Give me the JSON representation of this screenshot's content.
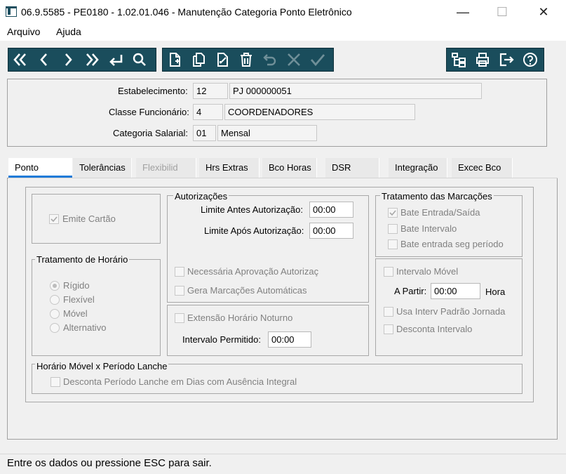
{
  "window": {
    "title": "06.9.5585 - PE0180 - 1.02.01.046 - Manutenção Categoria Ponto Eletrônico",
    "minimize": "—",
    "maximize": "☐",
    "close": "✕"
  },
  "menu": {
    "arquivo": "Arquivo",
    "ajuda": "Ajuda"
  },
  "toolbar": {
    "nav": [
      "first-icon",
      "prev-icon",
      "next-icon",
      "last-icon",
      "goto-icon",
      "search-icon"
    ],
    "edit": [
      "new-icon",
      "copy-icon",
      "modify-icon",
      "delete-icon",
      "undo-icon",
      "cancel-icon",
      "confirm-icon"
    ],
    "misc": [
      "tree-icon",
      "print-icon",
      "exit-icon",
      "help-icon"
    ],
    "color": "#1a4d5c"
  },
  "header": {
    "estab_label": "Estabelecimento:",
    "estab_code": "12",
    "estab_name": "PJ 000000051",
    "classe_label": "Classe Funcionário:",
    "classe_code": "4",
    "classe_name": "COORDENADORES",
    "categ_label": "Categoria Salarial:",
    "categ_code": "01",
    "categ_name": "Mensal"
  },
  "tabs": [
    {
      "label": "Ponto"
    },
    {
      "label": "Tolerâncias"
    },
    {
      "label": "Flexibilid"
    },
    {
      "label": "Hrs Extras"
    },
    {
      "label": "Bco Horas"
    },
    {
      "label": "DSR"
    },
    {
      "label": "Integração"
    },
    {
      "label": "Excec Bco"
    }
  ],
  "ponto": {
    "emite_cartao": "Emite Cartão",
    "tratamento_horario": {
      "title": "Tratamento de Horário",
      "options": [
        "Rígido",
        "Flexível",
        "Móvel",
        "Alternativo"
      ],
      "selected": "Rígido"
    },
    "autorizacoes": {
      "title": "Autorizações",
      "limite_antes_label": "Limite Antes Autorização:",
      "limite_antes_value": "00:00",
      "limite_apos_label": "Limite Após Autorização:",
      "limite_apos_value": "00:00",
      "necessaria": "Necessária Aprovação Autorizaç",
      "gera": "Gera Marcações Automáticas"
    },
    "extensao": {
      "label": "Extensão Horário Noturno",
      "intervalo_label": "Intervalo Permitido:",
      "intervalo_value": "00:00"
    },
    "tratamento_marcacoes": {
      "title": "Tratamento das Marcações",
      "bate_es": "Bate Entrada/Saída",
      "bate_intervalo": "Bate Intervalo",
      "bate_seg": "Bate entrada seg período"
    },
    "intervalo_movel": {
      "label": "Intervalo Móvel",
      "a_partir_label": "A Partir:",
      "a_partir_value": "00:00",
      "hora": "Hora",
      "usa_padrao": "Usa Interv Padrão Jornada",
      "desconta": "Desconta Intervalo"
    },
    "lanche": {
      "title": "Horário Móvel x Período Lanche",
      "desconta": "Desconta Período Lanche em Dias com Ausência Integral"
    }
  },
  "status": "Entre os dados ou pressione ESC para sair."
}
